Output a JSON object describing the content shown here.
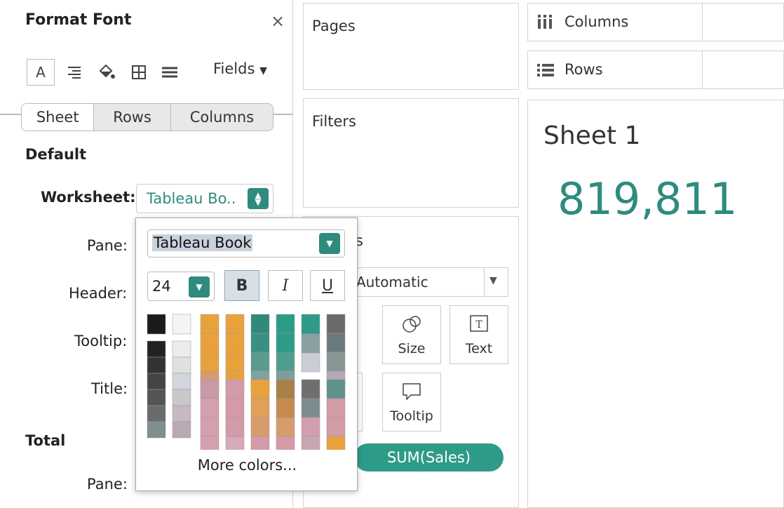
{
  "left_panel": {
    "title": "Format Font",
    "close_glyph": "×",
    "toolbar": {
      "icons": [
        "font-icon",
        "alignment-icon",
        "shading-icon",
        "borders-icon",
        "lines-icon"
      ],
      "font_glyph": "A",
      "fields_label": "Fields"
    },
    "tabs": [
      "Sheet",
      "Rows",
      "Columns"
    ],
    "active_tab": "Sheet",
    "default_heading": "Default",
    "rows": {
      "worksheet_label": "Worksheet:",
      "worksheet_value": "Tableau Bo..",
      "pane_label": "Pane:",
      "header_label": "Header:",
      "tooltip_label": "Tooltip:",
      "title_label": "Title:"
    },
    "total_heading": "Total",
    "total_pane_label": "Pane:"
  },
  "middle": {
    "pages_label": "Pages",
    "filters_label": "Filters",
    "marks": {
      "type_value": "Automatic",
      "size_label": "Size",
      "text_label": "Text",
      "tooltip_label": "Tooltip",
      "pill_label": "SUM(Sales)"
    }
  },
  "right": {
    "columns_label": "Columns",
    "rows_label": "Rows",
    "sheet_title": "Sheet 1",
    "value": "819,811"
  },
  "font_popup": {
    "font_name": "Tableau Book",
    "font_size": "24",
    "bold_label": "B",
    "italic_label": "I",
    "underline_label": "U",
    "more_colors": "More colors...",
    "accent": "#2e8b7e"
  }
}
